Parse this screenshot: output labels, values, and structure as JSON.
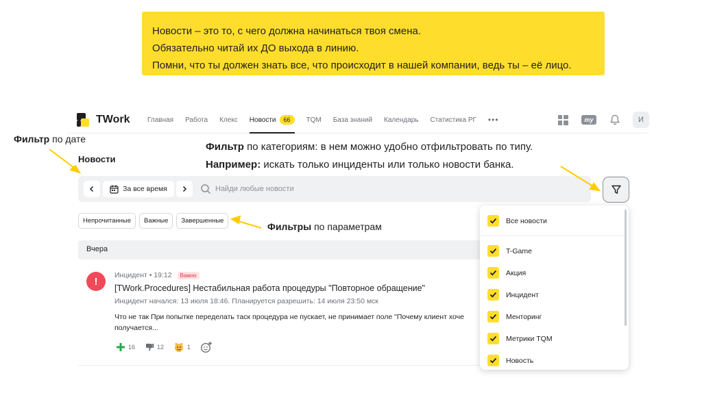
{
  "note": {
    "line1": "Новости – это то, с чего должна начинаться твоя смена.",
    "line2": "Обязательно читай их ДО выхода в линию.",
    "line3": "Помни, что ты должен знать все, что происходит в нашей компании, ведь ты – её лицо."
  },
  "app": {
    "logo": "TWork",
    "nav": [
      {
        "label": "Главная"
      },
      {
        "label": "Работа"
      },
      {
        "label": "Клекс"
      },
      {
        "label": "Новости",
        "badge": "66"
      },
      {
        "label": "TQM"
      },
      {
        "label": "База знаний"
      },
      {
        "label": "Календарь"
      },
      {
        "label": "Статистика РГ"
      }
    ],
    "more": "•••",
    "my_label": "my",
    "avatar": "И"
  },
  "page": {
    "title": "Новости",
    "date_filter": "За все время",
    "search_placeholder": "Найди любые новости",
    "chips": [
      "Непрочитанные",
      "Важные",
      "Завершенные"
    ],
    "day_label": "Вчера"
  },
  "news": {
    "icon": "!",
    "type": "Инцидент",
    "time": "• 19:12",
    "badge": "Важно",
    "title": "[TWork.Procedures] Нестабильная работа процедуры \"Повторное обращение\"",
    "subtitle": "Инцидент начался: 13 июля 18:46. Планируется разрешить: 14 июля 23:50 мск",
    "body_line1": "Что не так При попытке переделать таск процедура не пускает, не принимает поле \"Почему клиент хоче",
    "body_line2": "получается...",
    "reactions": {
      "plus": "16",
      "down": "12",
      "emoji": "1"
    }
  },
  "dropdown": {
    "items": [
      "Все новости",
      "T-Game",
      "Акция",
      "Инцидент",
      "Менторинг",
      "Метрики TQM",
      "Новость"
    ]
  },
  "annotations": {
    "date_bold": "Фильтр",
    "date_rest": " по дате",
    "cat_bold": "Фильтр",
    "cat_rest": " по категориям: в нем можно удобно отфильтровать по типу.",
    "example_bold": "Например:",
    "example_rest": " искать только инциденты или только новости банка.",
    "params_bold": "Фильтры",
    "params_rest": " по параметрам"
  },
  "colors": {
    "accent": "#ffdd2d",
    "danger": "#f04a5a",
    "green": "#2ea44f"
  }
}
